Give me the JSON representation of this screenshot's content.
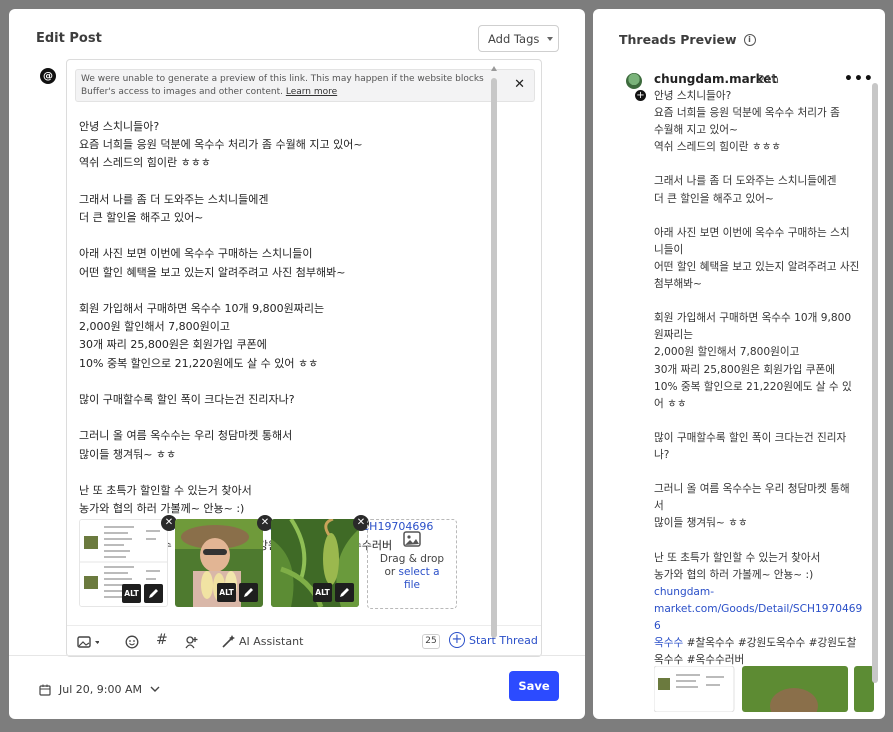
{
  "editor": {
    "title": "Edit Post",
    "add_tags_label": "Add Tags",
    "notice": {
      "text": "We were unable to generate a preview of this link. This may happen if the website blocks Buffer's access to images and other content.",
      "learn_more": "Learn more"
    },
    "post_lines": [
      "안녕 스치니들아?",
      "요즘 너희들 응원 덕분에 옥수수 처리가 좀 수월해 지고 있어~",
      "역쉬 스레드의 힘이란 ㅎㅎㅎ",
      "",
      "그래서 나를 좀 더 도와주는 스치니들에겐",
      "더 큰 할인을 해주고 있어~",
      "",
      "아래 사진 보면 이번에 옥수수 구매하는 스치니들이",
      "어떤 할인 혜택을 보고 있는지 알려주려고 사진 첨부해봐~",
      "",
      "회원 가입해서 구매하면 옥수수 10개 9,800원짜리는",
      "2,000원 할인해서 7,800원이고",
      "30개 짜리 25,800원은 회원가입 쿠폰에",
      "10% 중복 할인으로 21,220원에도 살 수 있어 ㅎㅎ",
      "",
      "많이 구매할수록 할인 폭이 크다는건 진리자나?",
      "",
      "그러니 올 여름 옥수수는 우리 청담마켓 통해서",
      "많이들 챙겨둬~ ㅎㅎ",
      "",
      "난 또 초특가 할인할 수 있는거 찾아서",
      "농가와 협의 하러 가볼께~ 안뇽~ :)"
    ],
    "link": "https://www.chungdam-market.com/Goods/Detail/SCH19704696",
    "hashtags": "#옥수수 #찰옥수수 #강원도옥수수 #강원도찰옥수수 #옥수수러버",
    "alt_label": "ALT",
    "dropzone": {
      "line1": "Drag & drop",
      "line2": "or",
      "select": "select a",
      "file": "file"
    },
    "toolbar": {
      "ai_label": "AI Assistant",
      "char_count": "25",
      "start_thread": "Start Thread"
    },
    "schedule": "Jul 20, 9:00 AM",
    "save_label": "Save"
  },
  "preview": {
    "title": "Threads Preview",
    "username": "chungdam.market",
    "time": "21h",
    "body": "안녕 스치니들아?\n요즘 너희들 응원 덕분에 옥수수 처리가 좀\n수월해 지고 있어~\n역쉬 스레드의 힘이란 ㅎㅎㅎ\n\n그래서 나를 좀 더 도와주는 스치니들에겐\n더 큰 할인을 해주고 있어~\n\n아래 사진 보면 이번에 옥수수 구매하는 스치\n니들이\n어떤 할인 혜택을 보고 있는지 알려주려고 사진\n첨부해봐~\n\n회원 가입해서 구매하면 옥수수 10개 9,800\n원짜리는\n2,000원 할인해서 7,800원이고\n30개 짜리 25,800원은 회원가입 쿠폰에\n10% 중복 할인으로 21,220원에도 살 수 있\n어 ㅎㅎ\n\n많이 구매할수록 할인 폭이 크다는건 진리자\n나?\n\n그러니 올 여름 옥수수는 우리 청담마켓 통해\n서\n많이들 챙겨둬~ ㅎㅎ\n\n난 또 초특가 할인할 수 있는거 찾아서\n농가와 협의 하러 가볼께~ 안뇽~ :)",
    "link_lines": [
      "chungdam-",
      "market.com/Goods/Detail/SCH1970469",
      "6"
    ],
    "hashtag_first": "옥수수",
    "hashtag_rest": " #찰옥수수 #강원도옥수수 #강원도찰\n옥수수 #옥수수러버"
  },
  "colors": {
    "accent": "#2c4bff",
    "link": "#2a4fc8"
  }
}
